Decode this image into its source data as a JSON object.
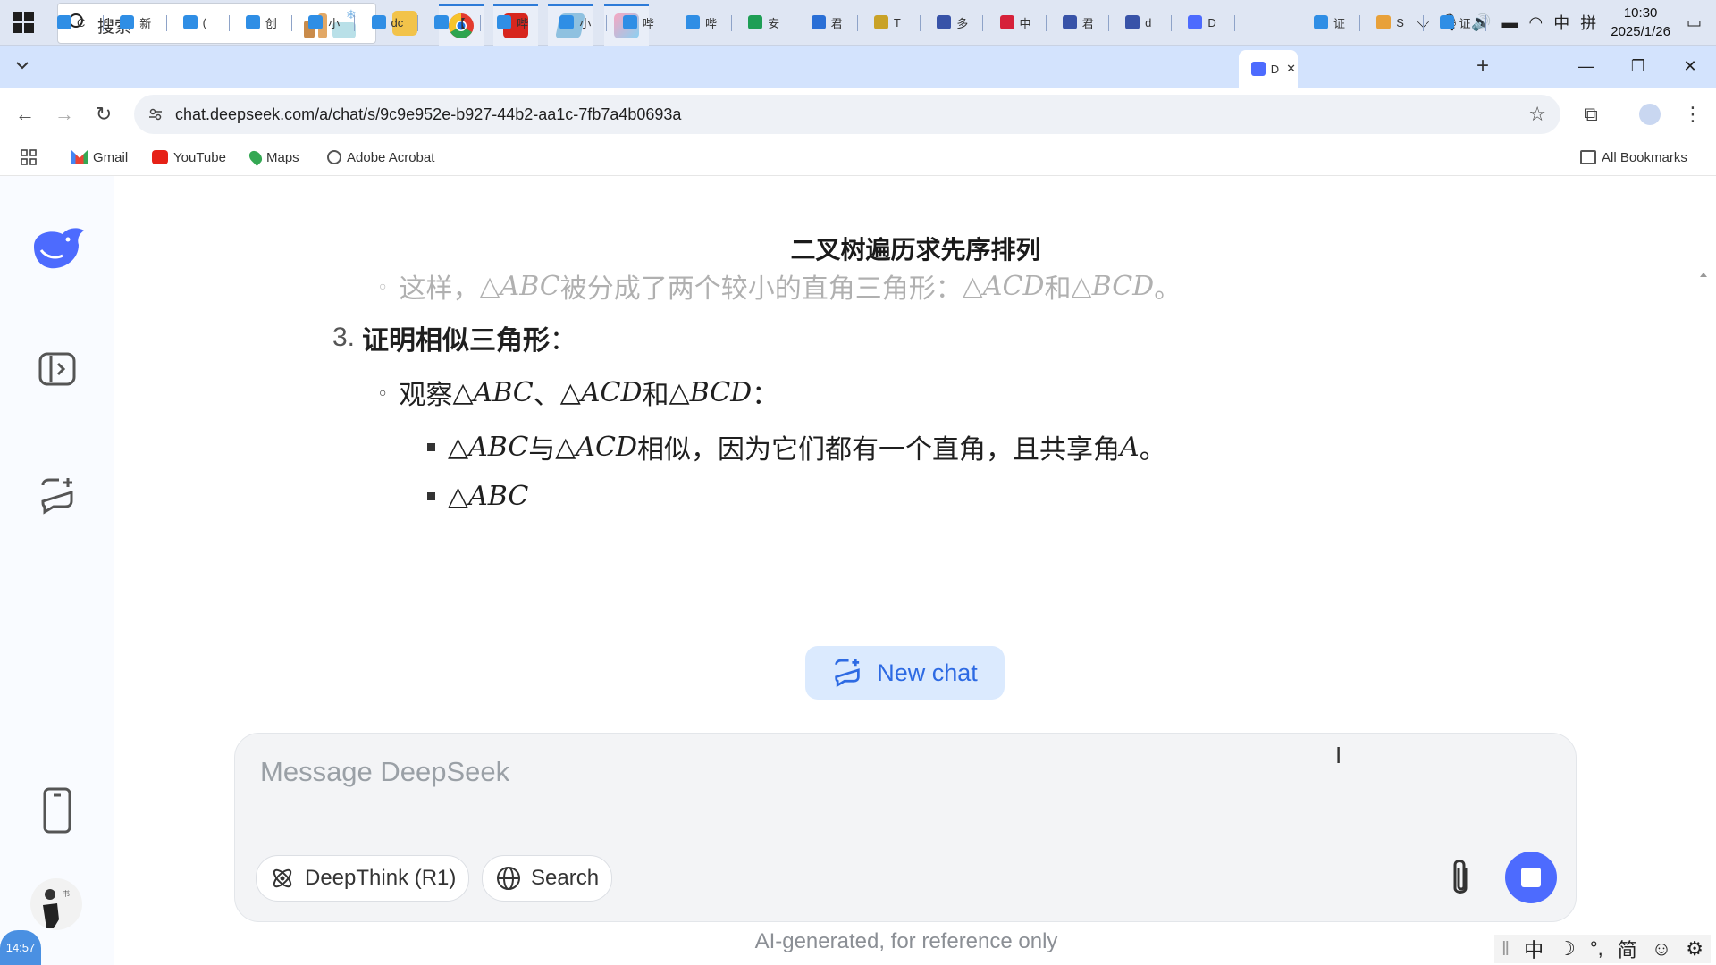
{
  "taskbar": {
    "search_placeholder": "搜索",
    "tray_icons": [
      "chevron-up-icon",
      "mic-icon",
      "volume-icon",
      "battery-icon",
      "wifi-icon"
    ],
    "ime_lang": "中",
    "ime_mode": "拼",
    "time": "10:30",
    "date": "2025/1/26"
  },
  "tabs": [
    {
      "label": "C",
      "fav": "#2f8ee5"
    },
    {
      "label": "新",
      "fav": "#2f8ee5"
    },
    {
      "label": "(",
      "fav": "#2f8ee5"
    },
    {
      "label": "创",
      "fav": "#2f8ee5"
    },
    {
      "label": "小",
      "fav": "#2f8ee5"
    },
    {
      "label": "dc",
      "fav": "#2f8ee5"
    },
    {
      "label": "【",
      "fav": "#2f8ee5"
    },
    {
      "label": "哔",
      "fav": "#2f8ee5"
    },
    {
      "label": "小",
      "fav": "#2f8ee5"
    },
    {
      "label": "哔",
      "fav": "#2f8ee5"
    },
    {
      "label": "哔",
      "fav": "#2f8ee5"
    },
    {
      "label": "安",
      "fav": "#1e9e55"
    },
    {
      "label": "君",
      "fav": "#2a6fd6"
    },
    {
      "label": "T",
      "fav": "#c9a227"
    },
    {
      "label": "多",
      "fav": "#3853a8"
    },
    {
      "label": "中",
      "fav": "#d6213a"
    },
    {
      "label": "君",
      "fav": "#3853a8"
    },
    {
      "label": "d",
      "fav": "#3853a8"
    },
    {
      "label": "D",
      "fav": "#4d6bfe"
    },
    {
      "label": "D",
      "fav": "#4d6bfe",
      "active": true
    },
    {
      "label": "证",
      "fav": "#2f8ee5"
    },
    {
      "label": "S",
      "fav": "#e8a13a"
    },
    {
      "label": "证",
      "fav": "#2f8ee5"
    }
  ],
  "address": {
    "url": "chat.deepseek.com/a/chat/s/9c9e952e-b927-44b2-aa1c-7fb7a4b0693a"
  },
  "bookmarks": [
    {
      "label": "Gmail",
      "icon": "gmail-icon"
    },
    {
      "label": "YouTube",
      "icon": "youtube-icon"
    },
    {
      "label": "Maps",
      "icon": "maps-icon"
    },
    {
      "label": "Adobe Acrobat",
      "icon": "acrobat-icon"
    }
  ],
  "all_bookmarks": "All Bookmarks",
  "chat": {
    "title": "二叉树遍历求先序排列",
    "line_faded": {
      "prefix": "这样，",
      "t1": "△ABC",
      "mid": " 被分成了两个较小的直角三角形：",
      "t2": "△ACD",
      "and": " 和 ",
      "t3": "△BCD",
      "end": "。"
    },
    "step3_num": "3.",
    "step3_title": "证明相似三角形",
    "step3_colon": "：",
    "observe": {
      "prefix": "观察 ",
      "t1": "△ABC",
      "sep": "、",
      "t2": "△ACD",
      "and": " 和 ",
      "t3": "△BCD",
      "end": "："
    },
    "bullet1": {
      "t1": "△ABC",
      "mid": " 与 ",
      "t2": "△ACD",
      "text": " 相似，因为它们都有一个直角，且共享角 ",
      "angle": "A",
      "end": "。"
    },
    "bullet2": {
      "t1": "△ABC"
    }
  },
  "new_chat_label": "New chat",
  "composer": {
    "placeholder": "Message DeepSeek",
    "deepthink_label": "DeepThink (R1)",
    "search_label": "Search"
  },
  "disclaimer": "AI-generated, for reference only",
  "ime_bar": [
    "中",
    "☽",
    "°,",
    "简",
    "☺",
    "⚙"
  ],
  "bubble_time": "14:57",
  "colors": {
    "accent": "#4d6bfe",
    "newchat_bg": "#dbeafe",
    "tabstrip": "#d3e3fd"
  }
}
